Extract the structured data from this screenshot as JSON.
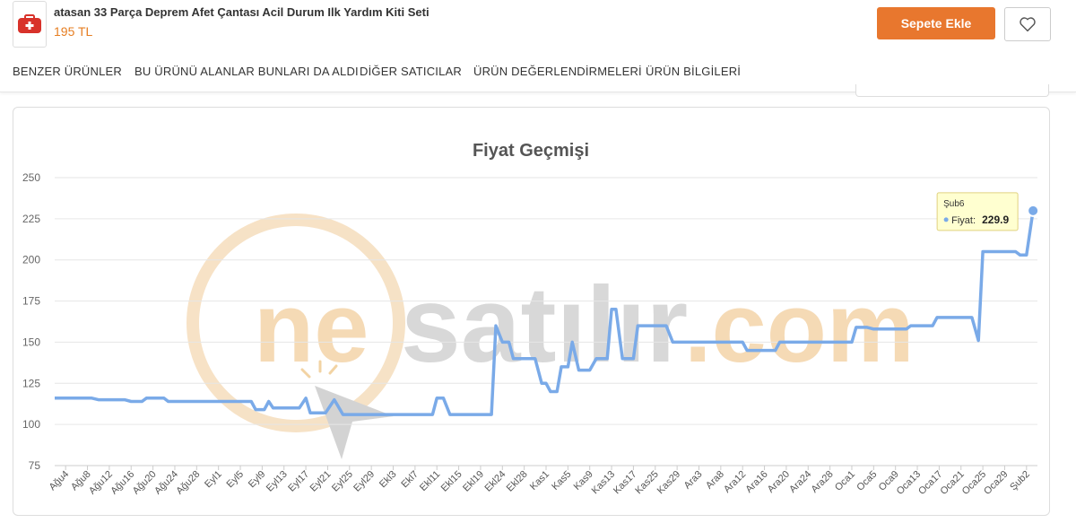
{
  "product": {
    "title": "atasan 33 Parça Deprem Afet Çantası Acil Durum Ilk Yardım Kiti Seti",
    "price": "195 TL",
    "thumbnail_icon": "first-aid-bag-icon"
  },
  "actions": {
    "add_to_cart_label": "Sepete Ekle",
    "favorite_icon": "heart-icon",
    "accent_color": "#e8772e"
  },
  "tabs": [
    {
      "label": "BENZER ÜRÜNLER"
    },
    {
      "label": "BU ÜRÜNÜ ALANLAR BUNLARI DA ALDI"
    },
    {
      "label": "DİĞER SATICILAR"
    },
    {
      "label": "ÜRÜN DEĞERLENDİRMELERİ"
    },
    {
      "label": "ÜRÜN BİLGİLERİ"
    }
  ],
  "watermark": {
    "text_ne": "ne",
    "text_satilir": "satılır",
    "text_com": ".com"
  },
  "chart_data": {
    "type": "line",
    "title": "Fiyat Geçmişi",
    "xlabel": "",
    "ylabel": "",
    "ylim": [
      75,
      250
    ],
    "yticks": [
      75,
      100,
      125,
      150,
      175,
      200,
      225,
      250
    ],
    "grid": true,
    "line_color": "#7aaae8",
    "x_tick_labels": [
      "Ağu4",
      "Ağu8",
      "Ağu12",
      "Ağu16",
      "Ağu20",
      "Ağu24",
      "Ağu28",
      "Eyl1",
      "Eyl5",
      "Eyl9",
      "Eyl13",
      "Eyl17",
      "Eyl21",
      "Eyl25",
      "Eyl29",
      "Ekl3",
      "Ekl7",
      "Ekl11",
      "Ekl15",
      "Ekl19",
      "Ekl24",
      "Ekl28",
      "Kas1",
      "Kas5",
      "Kas9",
      "Kas13",
      "Kas17",
      "Kas25",
      "Kas29",
      "Ara3",
      "Ara8",
      "Ara12",
      "Ara16",
      "Ara20",
      "Ara24",
      "Ara28",
      "Oca1",
      "Oca5",
      "Oca9",
      "Oca13",
      "Oca17",
      "Oca21",
      "Oca25",
      "Oca29",
      "Şub2"
    ],
    "series": [
      {
        "points": [
          [
            0,
            116
          ],
          [
            1.7,
            116
          ],
          [
            2,
            115
          ],
          [
            3.2,
            115
          ],
          [
            3.5,
            114
          ],
          [
            4,
            114
          ],
          [
            4.2,
            116
          ],
          [
            5,
            116
          ],
          [
            5.2,
            114
          ],
          [
            9,
            114
          ],
          [
            9.2,
            109
          ],
          [
            9.6,
            109
          ],
          [
            9.8,
            114
          ],
          [
            10,
            110
          ],
          [
            11.2,
            110
          ],
          [
            11.5,
            116
          ],
          [
            11.7,
            107
          ],
          [
            12.4,
            107
          ],
          [
            12.8,
            115
          ],
          [
            13.2,
            106
          ],
          [
            17.3,
            106
          ],
          [
            17.5,
            116
          ],
          [
            17.8,
            116
          ],
          [
            18.1,
            106
          ],
          [
            20,
            106
          ],
          [
            20.2,
            160
          ],
          [
            20.5,
            150
          ],
          [
            20.8,
            150
          ],
          [
            21,
            140
          ],
          [
            22,
            140
          ],
          [
            22.3,
            125
          ],
          [
            22.5,
            125
          ],
          [
            22.7,
            120
          ],
          [
            23,
            120
          ],
          [
            23.2,
            135
          ],
          [
            23.5,
            135
          ],
          [
            23.7,
            150
          ],
          [
            24,
            133
          ],
          [
            24.5,
            133
          ],
          [
            24.8,
            140
          ],
          [
            25,
            140
          ],
          [
            25.3,
            140
          ],
          [
            25.5,
            170
          ],
          [
            25.7,
            170
          ],
          [
            26,
            140
          ],
          [
            26.5,
            140
          ],
          [
            26.7,
            160
          ],
          [
            28,
            160
          ],
          [
            28.3,
            150
          ],
          [
            31.5,
            150
          ],
          [
            31.7,
            145
          ],
          [
            33,
            145
          ],
          [
            33.2,
            150
          ],
          [
            36.5,
            150
          ],
          [
            36.7,
            159
          ],
          [
            37.2,
            159
          ],
          [
            37.5,
            158
          ],
          [
            39,
            158
          ],
          [
            39.2,
            160
          ],
          [
            40.2,
            160
          ],
          [
            40.4,
            165
          ],
          [
            42,
            165
          ],
          [
            42.3,
            151
          ],
          [
            42.5,
            205
          ],
          [
            44,
            205
          ],
          [
            44.2,
            203
          ],
          [
            44.5,
            203
          ],
          [
            44.8,
            229.9
          ]
        ]
      }
    ],
    "tooltip": {
      "date": "Şub6",
      "series_label": "Fiyat",
      "value": "229.9"
    }
  }
}
